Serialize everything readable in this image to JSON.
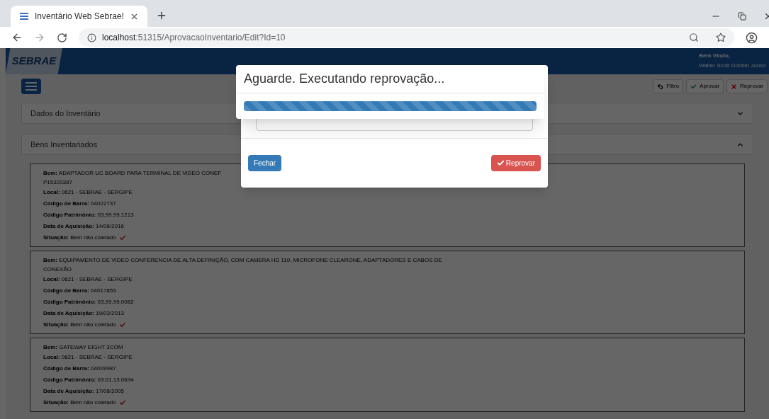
{
  "browser": {
    "tab_title": "Inventário Web Sebrae!",
    "url_host": "localhost",
    "url_path": ":51315/AprovacaoInventario/Edit?Id=10"
  },
  "header": {
    "logo": "SEBRAE",
    "welcome": "Bem Vindo,",
    "user": "Walter Scott Dobbin Junior"
  },
  "toolbar": {
    "buttons": [
      {
        "label": "Filtro",
        "kind": "back"
      },
      {
        "label": "Aprovar",
        "kind": "approve"
      },
      {
        "label": "Reprovar",
        "kind": "reject"
      }
    ]
  },
  "panels": [
    {
      "title": "Dados do Inventário",
      "expanded": false
    },
    {
      "title": "Bens Inventariados",
      "expanded": true
    }
  ],
  "items": [
    {
      "bem_label": "Bem:",
      "bem": [
        "ADAPTADOR UC BOARD PARA TERMINAL DE VIDEO CONEF",
        "P15320387"
      ],
      "fields": [
        {
          "label": "Local:",
          "value": "0621 - SEBRAE - SERGIPE"
        },
        {
          "label": "Código de Barra:",
          "value": "04022737"
        },
        {
          "label": "Código Patrimônio:",
          "value": "03.99.99.1213"
        },
        {
          "label": "Data de Aquisição:",
          "value": "14/06/2016"
        },
        {
          "label": "Situação:",
          "value": "Bem não coletado"
        }
      ]
    },
    {
      "bem_label": "Bem:",
      "bem": [
        "EQUIPAMENTO DE VIDEO CONFERENCIA DE ALTA DEFINIÇÃO, COM CAMERA HD 110, MICROFONE CLEARONE, ADAPTADORES E CABOS DE",
        "CONEXÃO"
      ],
      "fields": [
        {
          "label": "Local:",
          "value": "0621 - SEBRAE - SERGIPE"
        },
        {
          "label": "Código de Barra:",
          "value": "04017855"
        },
        {
          "label": "Código Patrimônio:",
          "value": "03.99.99.0082"
        },
        {
          "label": "Data de Aquisição:",
          "value": "19/03/2013"
        },
        {
          "label": "Situação:",
          "value": "Bem não coletado"
        }
      ]
    },
    {
      "bem_label": "Bem:",
      "bem": [
        "GATEWAY EIGHT 3COM"
      ],
      "fields": [
        {
          "label": "Local:",
          "value": "0621 - SEBRAE - SERGIPE"
        },
        {
          "label": "Código de Barra:",
          "value": "04009987"
        },
        {
          "label": "Código Patrimônio:",
          "value": "03.01.13.0694"
        },
        {
          "label": "Data de Aquisição:",
          "value": "17/08/2005"
        },
        {
          "label": "Situação:",
          "value": "Bem não coletado"
        }
      ]
    }
  ],
  "modal": {
    "buttons": [
      {
        "label": "Fechar",
        "kind": "close"
      },
      {
        "label": "Reprovar",
        "kind": "reject"
      }
    ]
  },
  "progress_dialog": {
    "title": "Aguarde. Executando reprovação...",
    "level": 1
  }
}
